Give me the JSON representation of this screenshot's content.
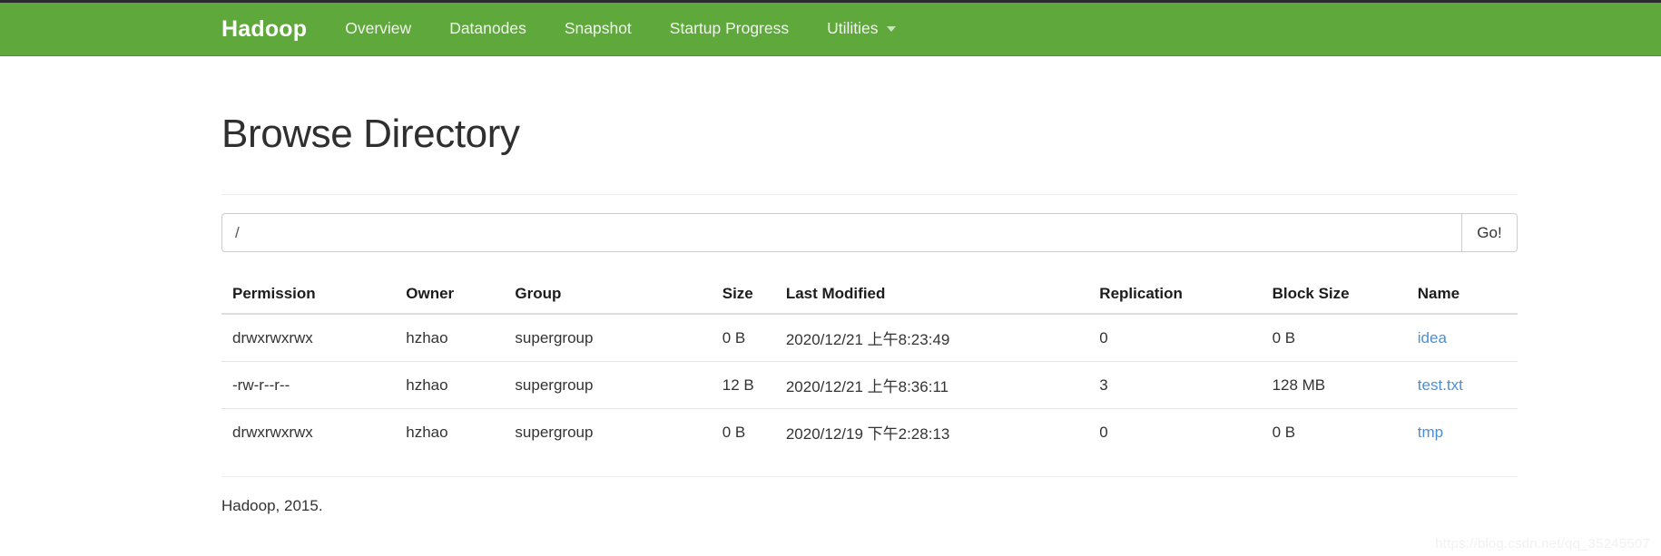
{
  "navbar": {
    "brand": "Hadoop",
    "brand_color": "#ffffff",
    "background_color": "#5fa83c",
    "links": [
      {
        "label": "Overview"
      },
      {
        "label": "Datanodes"
      },
      {
        "label": "Snapshot"
      },
      {
        "label": "Startup Progress"
      }
    ],
    "dropdown": {
      "label": "Utilities",
      "icon": "caret-down-icon"
    }
  },
  "page": {
    "title": "Browse Directory"
  },
  "path_form": {
    "value": "/",
    "placeholder": "",
    "go_label": "Go!"
  },
  "table": {
    "columns": [
      "Permission",
      "Owner",
      "Group",
      "Size",
      "Last Modified",
      "Replication",
      "Block Size",
      "Name"
    ],
    "rows": [
      {
        "permission": "drwxrwxrwx",
        "owner": "hzhao",
        "group": "supergroup",
        "size": "0 B",
        "last_modified": "2020/12/21 上午8:23:49",
        "replication": "0",
        "block_size": "0 B",
        "name": "idea"
      },
      {
        "permission": "-rw-r--r--",
        "owner": "hzhao",
        "group": "supergroup",
        "size": "12 B",
        "last_modified": "2020/12/21 上午8:36:11",
        "replication": "3",
        "block_size": "128 MB",
        "name": "test.txt"
      },
      {
        "permission": "drwxrwxrwx",
        "owner": "hzhao",
        "group": "supergroup",
        "size": "0 B",
        "last_modified": "2020/12/19 下午2:28:13",
        "replication": "0",
        "block_size": "0 B",
        "name": "tmp"
      }
    ],
    "link_color": "#4a8fd4"
  },
  "footer": {
    "text": "Hadoop, 2015."
  },
  "watermark": {
    "text": "https://blog.csdn.net/qq_35245507"
  }
}
